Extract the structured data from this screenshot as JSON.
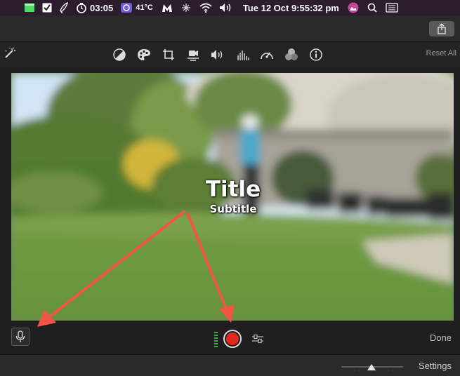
{
  "menubar": {
    "timer": "03:05",
    "temperature": "41°C",
    "datetime": "Tue 12 Oct  9:55:32 pm",
    "icons": [
      "battery-icon",
      "checklist-icon",
      "pen-app-icon",
      "timer-icon",
      "cpu-monitor-icon",
      "malwarebytes-icon",
      "dropbox-icon",
      "wifi-icon",
      "volume-icon",
      "user-avatar-icon",
      "spotlight-search-icon",
      "control-center-icon"
    ]
  },
  "adjustments": {
    "reset_label": "Reset All",
    "tools": [
      "color-balance-icon",
      "color-correction-icon",
      "crop-icon",
      "stabilization-icon",
      "volume-icon",
      "noise-reduction-icon",
      "speed-icon",
      "clip-filter-icon",
      "info-icon"
    ]
  },
  "viewer": {
    "title": "Title",
    "subtitle": "Subtitle"
  },
  "controls": {
    "done_label": "Done"
  },
  "footer": {
    "settings_label": "Settings"
  },
  "colors": {
    "record": "#e5251f",
    "annotation_arrow": "#f05545"
  }
}
